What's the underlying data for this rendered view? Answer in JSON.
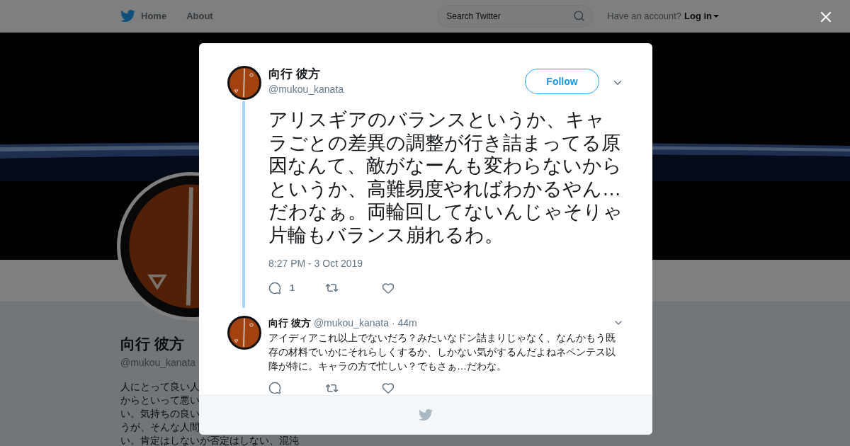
{
  "nav": {
    "items": [
      {
        "label": "Home"
      },
      {
        "label": "About"
      }
    ],
    "search": {
      "placeholder": "Search Twitter"
    },
    "account_prompt": "Have an account?",
    "login": "Log in"
  },
  "profile": {
    "name": "向行 彼方",
    "handle": "@mukou_kanata",
    "bio_lines": [
      "人にとって良い人",
      "からといって悪い",
      "い。気持ちの良い",
      "うが、そんな人間",
      "い。肯定はしないが否定はしない、混沌"
    ]
  },
  "tweet": {
    "name": "向行 彼方",
    "handle": "@mukou_kanata",
    "follow": "Follow",
    "text": "アリスギアのバランスというか、キャラごとの差異の調整が行き詰まってる原因なんて、敵がなーんも変わらないからというか、高難易度やればわかるやん…だわなぁ。両輪回してないんじゃそりゃ片輪もバランス崩れるわ。",
    "timestamp": "8:27 PM - 3 Oct 2019",
    "reply_count": "1"
  },
  "reply": {
    "name": "向行 彼方",
    "handle": "@mukou_kanata",
    "age": "· 44m",
    "text": "アイディアこれ以上でないだろ？みたいなドン詰まりじゃなく、なんかもう既存の材料でいかにそれらしくするか、しかない気がするんだよねネペンテス以降が特に。キャラの方で忙しい？でもさぁ…だわな。"
  }
}
